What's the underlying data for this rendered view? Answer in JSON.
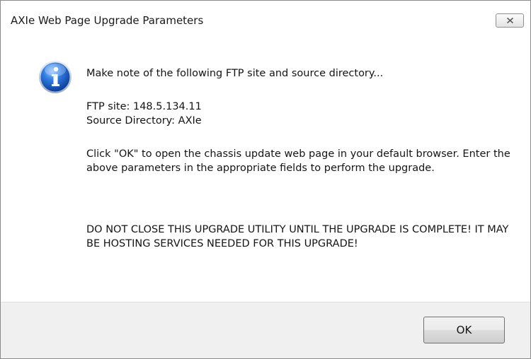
{
  "window": {
    "title": "AXIe Web Page Upgrade Parameters"
  },
  "icons": {
    "message_icon": "information-icon",
    "close_icon": "close-icon"
  },
  "message": {
    "intro": "Make note of the following FTP site and source directory...",
    "ftp_site": "FTP site: 148.5.134.11",
    "source_directory": "Source Directory: AXIe",
    "instructions": "Click \"OK\" to open the chassis update web page in your default browser.  Enter the above parameters in the appropriate fields to perform the upgrade.",
    "warning": "DO NOT CLOSE THIS UPGRADE UTILITY UNTIL THE UPGRADE IS COMPLETE!  IT MAY BE HOSTING SERVICES NEEDED FOR THIS UPGRADE!"
  },
  "buttons": {
    "ok_label": "OK"
  },
  "colors": {
    "footer_background": "#f0f0f0",
    "info_icon_blue": "#1f5fbf"
  }
}
